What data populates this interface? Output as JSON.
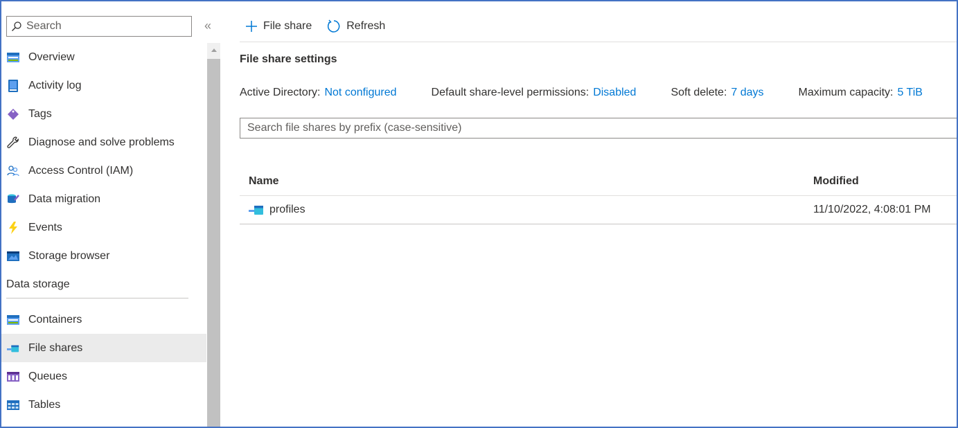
{
  "sidebar": {
    "search_placeholder": "Search",
    "collapse_glyph": "«",
    "items": [
      {
        "label": "Overview",
        "icon": "overview-icon"
      },
      {
        "label": "Activity log",
        "icon": "activity-log-icon"
      },
      {
        "label": "Tags",
        "icon": "tag-icon"
      },
      {
        "label": "Diagnose and solve problems",
        "icon": "wrench-icon"
      },
      {
        "label": "Access Control (IAM)",
        "icon": "people-icon"
      },
      {
        "label": "Data migration",
        "icon": "data-migration-icon"
      },
      {
        "label": "Events",
        "icon": "lightning-icon"
      },
      {
        "label": "Storage browser",
        "icon": "storage-browser-icon"
      }
    ],
    "section_title": "Data storage",
    "section_items": [
      {
        "label": "Containers",
        "icon": "container-icon"
      },
      {
        "label": "File shares",
        "icon": "file-share-icon",
        "active": true
      },
      {
        "label": "Queues",
        "icon": "queue-icon"
      },
      {
        "label": "Tables",
        "icon": "table-icon"
      }
    ]
  },
  "toolbar": {
    "add_label": "File share",
    "refresh_label": "Refresh"
  },
  "settings": {
    "title": "File share settings",
    "active_directory": {
      "key": "Active Directory:",
      "value": "Not configured"
    },
    "permissions": {
      "key": "Default share-level permissions:",
      "value": "Disabled"
    },
    "soft_delete": {
      "key": "Soft delete:",
      "value": "7 days"
    },
    "max_capacity": {
      "key": "Maximum capacity:",
      "value": "5 TiB"
    }
  },
  "filter": {
    "placeholder": "Search file shares by prefix (case-sensitive)"
  },
  "table": {
    "headers": {
      "name": "Name",
      "modified": "Modified"
    },
    "rows": [
      {
        "name": "profiles",
        "modified": "11/10/2022, 4:08:01 PM"
      }
    ]
  },
  "colors": {
    "accent": "#0078d4",
    "frame": "#4472c4",
    "active_bg": "#ebebeb"
  }
}
